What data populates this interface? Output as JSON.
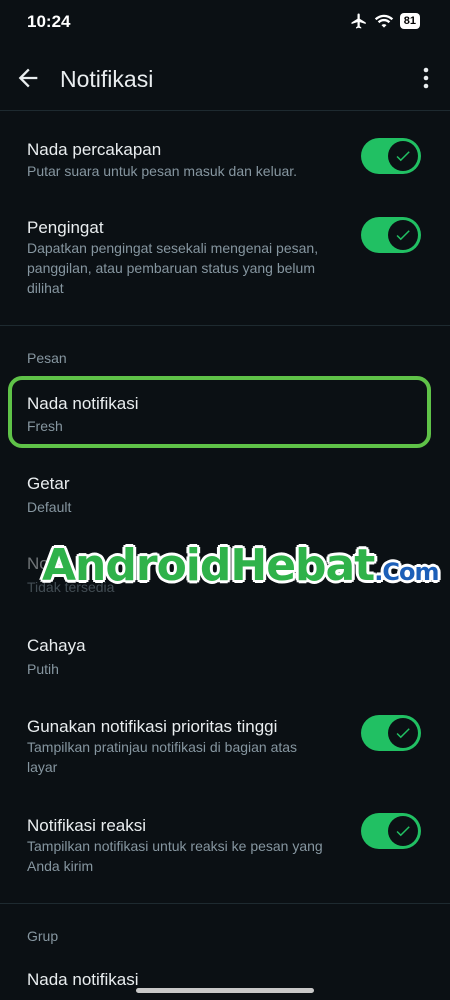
{
  "status_bar": {
    "time": "10:24",
    "battery": "81"
  },
  "app_bar": {
    "title": "Notifikasi"
  },
  "toggles": {
    "nada_percakapan": {
      "title": "Nada percakapan",
      "subtitle": "Putar suara untuk pesan masuk dan keluar.",
      "on": true
    },
    "pengingat": {
      "title": "Pengingat",
      "subtitle": "Dapatkan pengingat sesekali mengenai pesan, panggilan, atau pembaruan status yang belum dilihat",
      "on": true
    }
  },
  "pesan": {
    "header": "Pesan",
    "nada_notifikasi": {
      "title": "Nada notifikasi",
      "value": "Fresh"
    },
    "getar": {
      "title": "Getar",
      "value": "Default"
    },
    "obscured_row": {
      "title": "No",
      "value": "Tidak tersedia"
    },
    "cahaya": {
      "title": "Cahaya",
      "value": "Putih"
    },
    "prioritas": {
      "title": "Gunakan notifikasi prioritas tinggi",
      "subtitle": "Tampilkan pratinjau notifikasi di bagian atas layar",
      "on": true
    },
    "reaksi": {
      "title": "Notifikasi reaksi",
      "subtitle": "Tampilkan notifikasi untuk reaksi ke pesan yang Anda kirim",
      "on": true
    }
  },
  "grup": {
    "header": "Grup",
    "nada_notifikasi": {
      "title": "Nada notifikasi"
    }
  },
  "watermark": {
    "main": "AndroidHebat",
    "suffix": ".Com"
  },
  "colors": {
    "accent": "#21c063",
    "background": "#0b1014",
    "highlight": "#5fc248"
  },
  "icons": [
    "back-arrow-icon",
    "more-vert-icon",
    "airplane-icon",
    "wifi-icon",
    "battery-icon",
    "check-icon"
  ]
}
